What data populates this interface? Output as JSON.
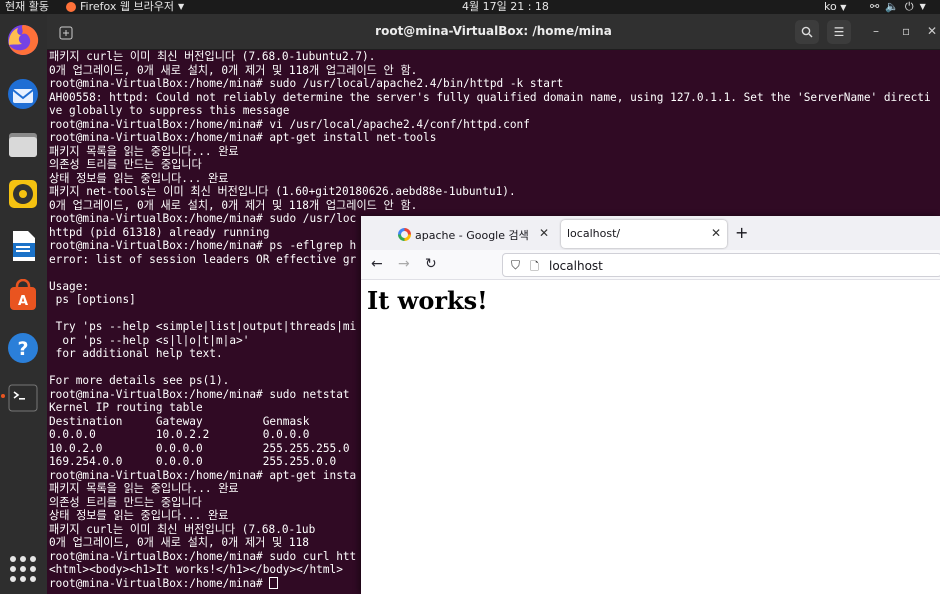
{
  "topbar": {
    "activities": "현재 활동",
    "app_name": "Firefox 웹 브라우저",
    "clock": "4월 17일 21 : 18",
    "language": "ko"
  },
  "dock": {
    "items": [
      "firefox",
      "thunderbird",
      "files",
      "rhythmbox",
      "libreoffice-writer",
      "ubuntu-software",
      "help",
      "terminal"
    ]
  },
  "terminal": {
    "title": "root@mina-VirtualBox: /home/mina",
    "lines": [
      "패키지 curl는 이미 최신 버전입니다 (7.68.0-1ubuntu2.7).",
      "0개 업그레이드, 0개 새로 설치, 0개 제거 및 118개 업그레이드 안 함.",
      "root@mina-VirtualBox:/home/mina# sudo /usr/local/apache2.4/bin/httpd -k start",
      "AH00558: httpd: Could not reliably determine the server's fully qualified domain name, using 127.0.1.1. Set the 'ServerName' directi",
      "ve globally to suppress this message",
      "root@mina-VirtualBox:/home/mina# vi /usr/local/apache2.4/conf/httpd.conf",
      "root@mina-VirtualBox:/home/mina# apt-get install net-tools",
      "패키지 목록을 읽는 중입니다... 완료",
      "의존성 트리를 만드는 중입니다",
      "상태 정보를 읽는 중입니다... 완료",
      "패키지 net-tools는 이미 최신 버전입니다 (1.60+git20180626.aebd88e-1ubuntu1).",
      "0개 업그레이드, 0개 새로 설치, 0개 제거 및 118개 업그레이드 안 함.",
      "root@mina-VirtualBox:/home/mina# sudo /usr/loc",
      "httpd (pid 61318) already running",
      "root@mina-VirtualBox:/home/mina# ps -eflgrep h",
      "error: list of session leaders OR effective gr",
      "",
      "Usage:",
      " ps [options]",
      "",
      " Try 'ps --help <simple|list|output|threads|mi",
      "  or 'ps --help <s|l|o|t|m|a>'",
      " for additional help text.",
      "",
      "For more details see ps(1).",
      "root@mina-VirtualBox:/home/mina# sudo netstat",
      "Kernel IP routing table",
      "Destination     Gateway         Genmask",
      "0.0.0.0         10.0.2.2        0.0.0.0",
      "10.0.2.0        0.0.0.0         255.255.255.0",
      "169.254.0.0     0.0.0.0         255.255.0.0",
      "root@mina-VirtualBox:/home/mina# apt-get insta",
      "패키지 목록을 읽는 중입니다... 완료",
      "의존성 트리를 만드는 중입니다",
      "상태 정보를 읽는 중입니다... 완료",
      "패키지 curl는 이미 최신 버전입니다 (7.68.0-1ub",
      "0개 업그레이드, 0개 새로 설치, 0개 제거 및 118",
      "root@mina-VirtualBox:/home/mina# sudo curl htt",
      "<html><body><h1>It works!</h1></body></html>",
      "root@mina-VirtualBox:/home/mina# "
    ]
  },
  "browser": {
    "tabs": [
      {
        "label": "apache - Google 검색",
        "active": false
      },
      {
        "label": "localhost/",
        "active": true
      }
    ],
    "url": "localhost",
    "page_heading": "It works!"
  }
}
